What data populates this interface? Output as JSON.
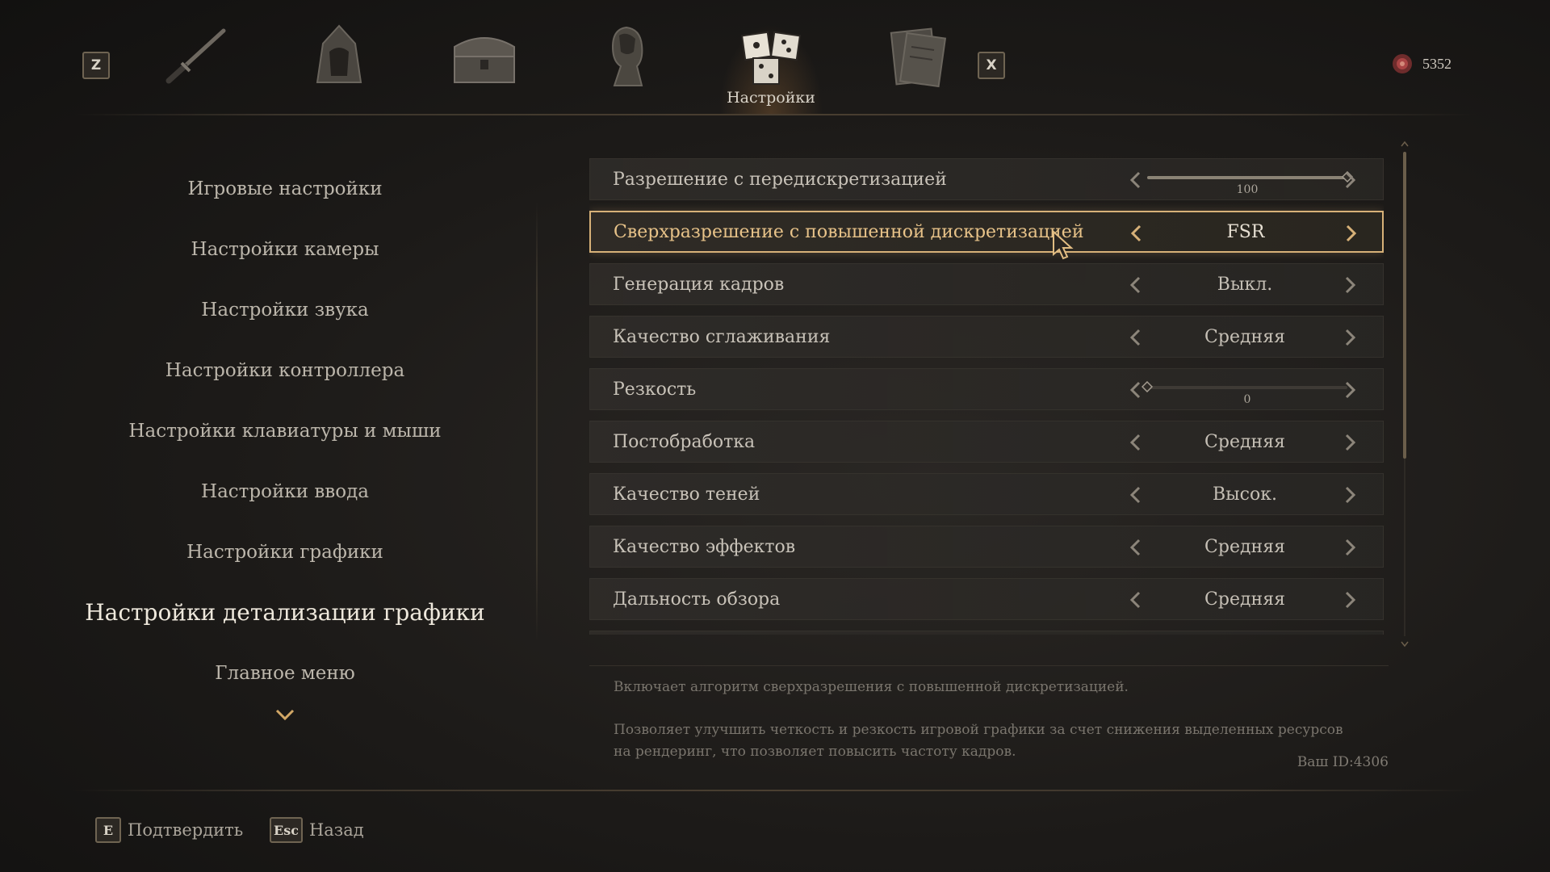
{
  "topbar": {
    "prev_key": "Z",
    "next_key": "X",
    "tabs": [
      {
        "icon": "katana-icon"
      },
      {
        "icon": "hood-icon"
      },
      {
        "icon": "chest-icon"
      },
      {
        "icon": "character-portrait-icon"
      },
      {
        "icon": "dice-settings-icon",
        "label": "Настройки",
        "active": true
      },
      {
        "icon": "scroll-map-icon"
      }
    ],
    "currency": {
      "icon": "red-flower-icon",
      "value": "5352"
    }
  },
  "sidebar": {
    "items": [
      {
        "label": "Игровые настройки"
      },
      {
        "label": "Настройки камеры"
      },
      {
        "label": "Настройки звука"
      },
      {
        "label": "Настройки контроллера"
      },
      {
        "label": "Настройки клавиатуры и мыши"
      },
      {
        "label": "Настройки ввода"
      },
      {
        "label": "Настройки графики"
      },
      {
        "label": "Настройки детализации графики",
        "active": true
      },
      {
        "label": "Главное меню"
      }
    ],
    "more_icon": "chevron-down-icon"
  },
  "settings": {
    "rows": [
      {
        "label": "Разрешение с передискретизацией",
        "type": "slider",
        "value": "100",
        "fraction": 1.0
      },
      {
        "label": "Сверхразрешение с повышенной дискретизацией",
        "type": "select",
        "value": "FSR",
        "selected": true
      },
      {
        "label": "Генерация кадров",
        "type": "select",
        "value": "Выкл."
      },
      {
        "label": "Качество сглаживания",
        "type": "select",
        "value": "Средняя"
      },
      {
        "label": "Резкость",
        "type": "slider",
        "value": "0",
        "fraction": 0.0
      },
      {
        "label": "Постобработка",
        "type": "select",
        "value": "Средняя"
      },
      {
        "label": "Качество теней",
        "type": "select",
        "value": "Высок."
      },
      {
        "label": "Качество эффектов",
        "type": "select",
        "value": "Средняя"
      },
      {
        "label": "Дальность обзора",
        "type": "select",
        "value": "Средняя"
      }
    ]
  },
  "description": {
    "line1": "Включает алгоритм сверхразрешения с повышенной дискретизацией.",
    "line2": "Позволяет улучшить четкость и резкость игровой графики за счет снижения выделенных ресурсов на рендеринг, что позволяет повысить частоту кадров.",
    "user_id": "Ваш ID:4306"
  },
  "footer": {
    "confirm_key": "E",
    "confirm_label": "Подтвердить",
    "back_key": "Esc",
    "back_label": "Назад"
  },
  "colors": {
    "accent": "#d7b178",
    "selected_text": "#e8c389",
    "background": "#1e1c1a"
  }
}
